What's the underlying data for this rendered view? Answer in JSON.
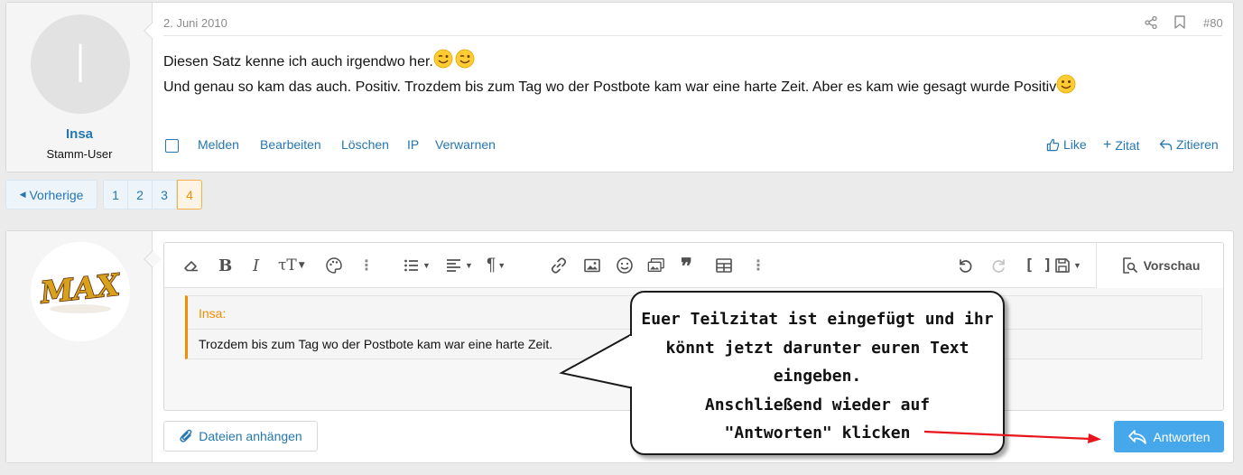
{
  "post": {
    "date": "2. Juni 2010",
    "number": "#80",
    "avatar_letter": "I",
    "user_name": "Insa",
    "user_title": "Stamm-User",
    "line1": "Diesen Satz kenne ich auch irgendwo her.",
    "line2": "Und genau so kam das auch. Positiv. Trozdem bis zum Tag wo der Postbote kam war eine harte Zeit. Aber es kam wie gesagt wurde Positiv",
    "actions": {
      "report": "Melden",
      "edit": "Bearbeiten",
      "delete": "Löschen",
      "ip": "IP",
      "warn": "Verwarnen",
      "like": "Like",
      "multiquote": "Zitat",
      "quote": "Zitieren"
    }
  },
  "pagination": {
    "prev_label": "Vorherige",
    "pages": [
      "1",
      "2",
      "3",
      "4"
    ],
    "current": "4"
  },
  "reply": {
    "avatar_logo_text": "MAX",
    "preview_label": "Vorschau",
    "quote_author": "Insa:",
    "quote_text": "Trozdem bis zum Tag wo der Postbote kam war eine harte Zeit.",
    "attach_label": "Dateien anhängen",
    "submit_label": "Antworten"
  },
  "annotation": {
    "lines": [
      "Euer Teilzitat ist eingefügt und ihr",
      "könnt jetzt darunter euren Text",
      "eingeben.",
      "Anschließend wieder auf",
      "\"Antworten\" klicken"
    ]
  },
  "colors": {
    "link": "#2577b1",
    "accent_orange": "#f18d00",
    "button_primary": "#47a7eb",
    "arrow_red": "#e8141b"
  }
}
